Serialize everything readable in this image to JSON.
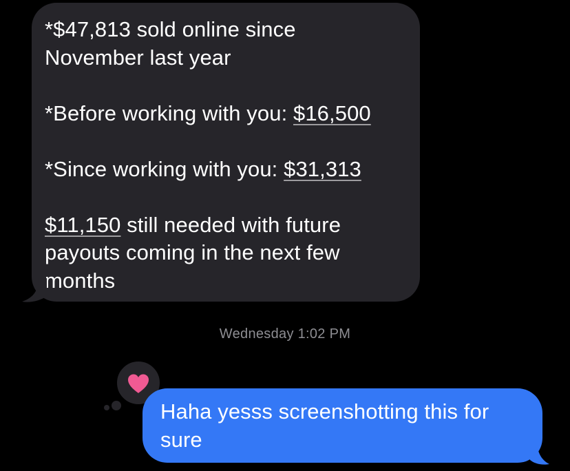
{
  "incoming_message": {
    "line1": "*$47,813 sold online since",
    "line2": "November last year",
    "before_prefix": "*Before working with you: ",
    "before_amount": "$16,500",
    "since_prefix": "*Since working with you: ",
    "since_amount": "$31,313",
    "needed_amount": "$11,150",
    "needed_suffix": " still needed with future",
    "line_payouts": "payouts coming in the next few",
    "line_months": "months"
  },
  "timestamp": {
    "label": "Wednesday 1:02 PM"
  },
  "outgoing_message": {
    "line1": "Haha yesss screenshotting this for",
    "line2": "sure"
  },
  "tapback": {
    "icon": "heart-icon",
    "color": "#f05a93"
  },
  "colors": {
    "background": "#000000",
    "incoming_bubble": "#26252a",
    "outgoing_bubble": "#3478f6",
    "timestamp_text": "#8e8e93"
  }
}
